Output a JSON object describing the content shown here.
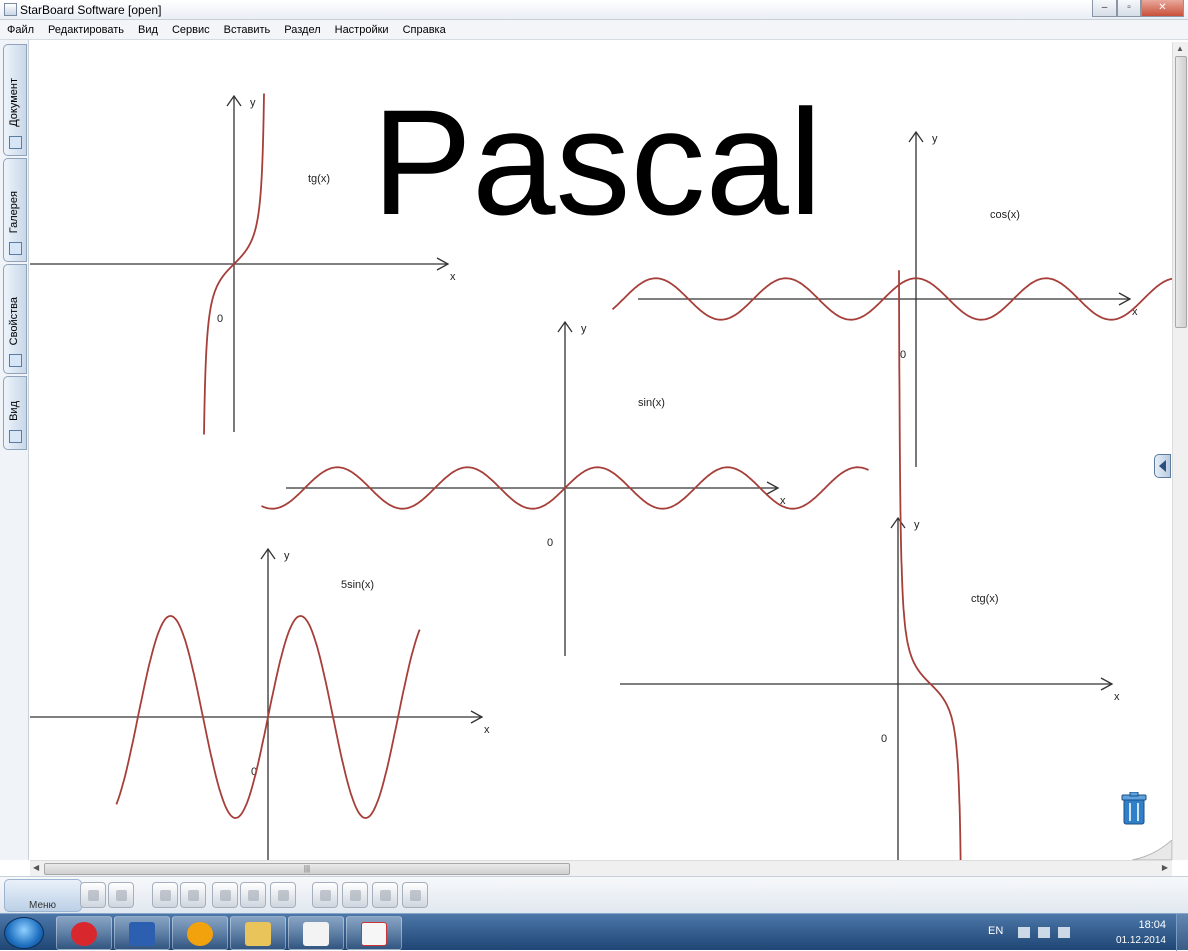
{
  "window": {
    "title": "StarBoard Software [open]",
    "btn_min": "–",
    "btn_max": "▫",
    "btn_close": "✕"
  },
  "menu": [
    "Файл",
    "Редактировать",
    "Вид",
    "Сервис",
    "Вставить",
    "Раздел",
    "Настройки",
    "Справка"
  ],
  "side_tabs": [
    "Документ",
    "Галерея",
    "Свойства",
    "Вид"
  ],
  "page": {
    "heading": "Pascal"
  },
  "graphs": [
    {
      "id": "tg",
      "label": "tg(x)",
      "type": "line",
      "fn": "tan",
      "x_label": "x",
      "y_label": "y",
      "origin_label": "0",
      "x_range": [
        -1.45,
        1.45
      ]
    },
    {
      "id": "cos",
      "label": "cos(x)",
      "type": "line",
      "fn": "cos",
      "x_label": "x",
      "y_label": "y",
      "origin_label": "0",
      "x_range": [
        -14.66,
        14.66
      ]
    },
    {
      "id": "sin",
      "label": "sin(x)",
      "type": "line",
      "fn": "sin",
      "x_label": "x",
      "y_label": "y",
      "origin_label": "0",
      "x_range": [
        -14.66,
        14.66
      ]
    },
    {
      "id": "5sin",
      "label": "5sin(x)",
      "type": "line",
      "fn": "5sin",
      "x_label": "x",
      "y_label": "y",
      "origin_label": "0",
      "x_range": [
        -7.33,
        7.33
      ]
    },
    {
      "id": "ctg",
      "label": "ctg(x)",
      "type": "line",
      "fn": "cot",
      "x_label": "x",
      "y_label": "y",
      "origin_label": "0",
      "x_range": [
        0.05,
        3.09
      ]
    }
  ],
  "colors": {
    "curve": "#a63f3a",
    "axis": "#333333"
  },
  "toolbar": {
    "menu_label": "Меню"
  },
  "taskbar": {
    "lang": "EN",
    "time": "18:04",
    "date": "01.12.2014"
  }
}
